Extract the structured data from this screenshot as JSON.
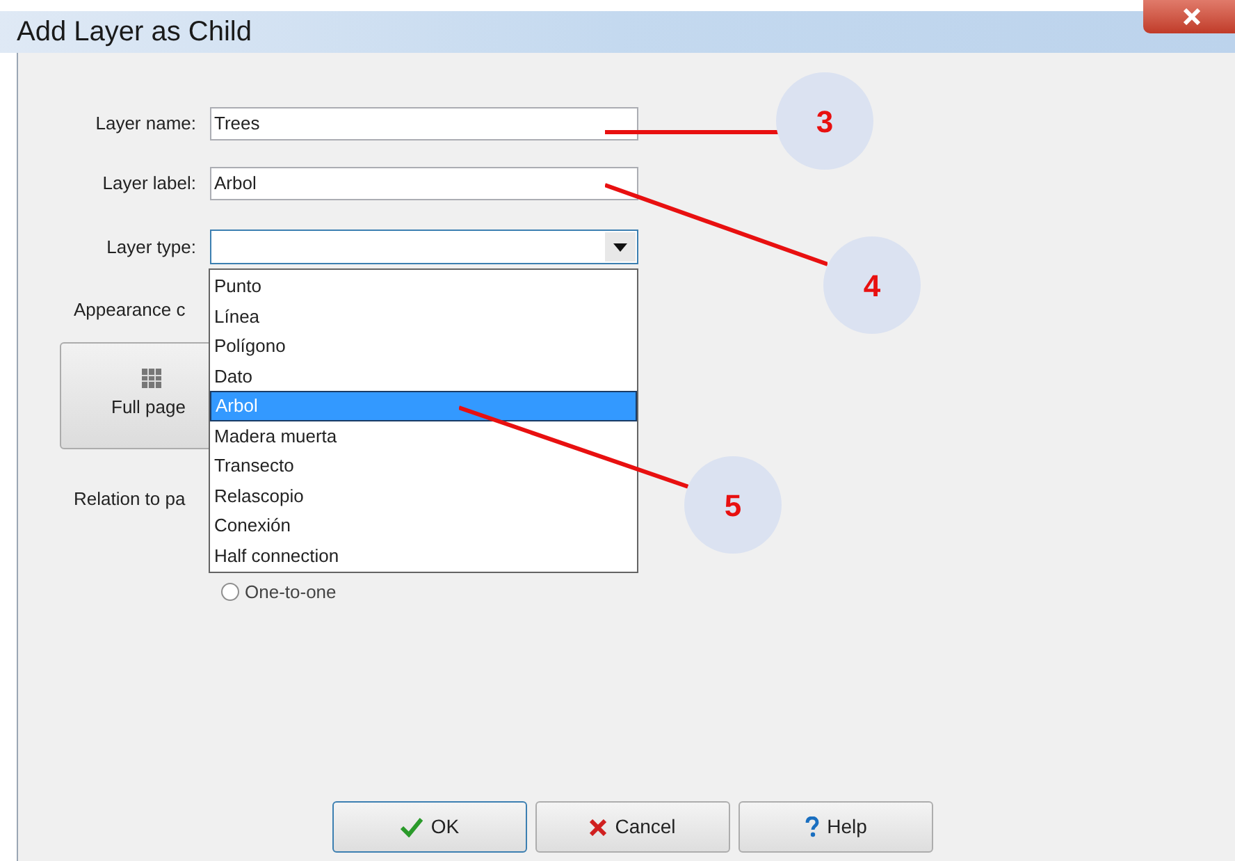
{
  "window": {
    "title": "Add Layer as Child"
  },
  "fields": [
    {
      "label": "Layer name:",
      "value": "Trees"
    },
    {
      "label": "Layer label:",
      "value": "Arbol"
    }
  ],
  "layer_type": {
    "label": "Layer type:",
    "expanded": true,
    "options": [
      {
        "label": "Punto",
        "selected": false
      },
      {
        "label": "Línea",
        "selected": false
      },
      {
        "label": "Polígono",
        "selected": false
      },
      {
        "label": "Dato",
        "selected": false
      },
      {
        "label": "Arbol",
        "selected": true
      },
      {
        "label": "Madera muerta",
        "selected": false
      },
      {
        "label": "Transecto",
        "selected": false
      },
      {
        "label": "Relascopio",
        "selected": false
      },
      {
        "label": "Conexión",
        "selected": false
      },
      {
        "label": "Half connection",
        "selected": false
      }
    ]
  },
  "appearance": {
    "label": "Appearance c",
    "options": [
      {
        "label": "Full page",
        "selected": false
      }
    ]
  },
  "relation": {
    "label": "Relation to pa",
    "options": [
      {
        "label": "One-to-one",
        "selected": false
      }
    ]
  },
  "buttons": [
    {
      "kind": "ok",
      "label": "OK"
    },
    {
      "kind": "cancel",
      "label": "Cancel"
    },
    {
      "kind": "help",
      "label": "Help"
    }
  ],
  "callouts": [
    {
      "number": "3"
    },
    {
      "number": "4"
    },
    {
      "number": "5"
    }
  ]
}
